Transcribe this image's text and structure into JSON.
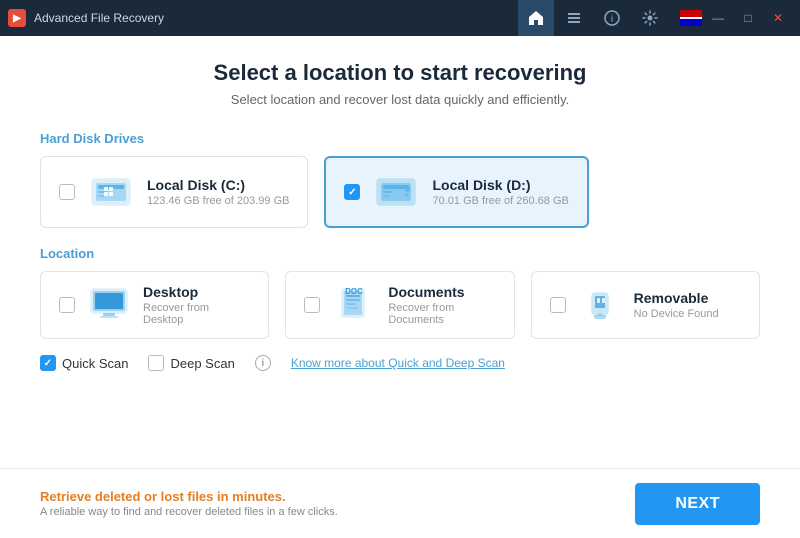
{
  "titlebar": {
    "app_name": "Advanced File Recovery",
    "tabs": [
      {
        "id": "home",
        "icon": "🏠",
        "active": true
      },
      {
        "id": "list",
        "icon": "☰",
        "active": false
      },
      {
        "id": "info",
        "icon": "ℹ",
        "active": false
      },
      {
        "id": "settings",
        "icon": "⚙",
        "active": false
      }
    ],
    "controls": {
      "minimize": "—",
      "maximize": "□",
      "close": "✕"
    }
  },
  "page": {
    "title": "Select a location to start recovering",
    "subtitle": "Select location and recover lost data quickly and efficiently."
  },
  "hard_disk_section": {
    "label": "Hard Disk Drives",
    "drives": [
      {
        "name": "Local Disk (C:)",
        "space": "123.46 GB free of 203.99 GB",
        "selected": false
      },
      {
        "name": "Local Disk (D:)",
        "space": "70.01 GB free of 260.68 GB",
        "selected": true
      }
    ]
  },
  "location_section": {
    "label": "Location",
    "locations": [
      {
        "name": "Desktop",
        "sub": "Recover from Desktop",
        "type": "desktop"
      },
      {
        "name": "Documents",
        "sub": "Recover from Documents",
        "type": "documents"
      },
      {
        "name": "Removable",
        "sub": "No Device Found",
        "type": "removable"
      }
    ]
  },
  "scan_options": {
    "quick_scan": {
      "label": "Quick Scan",
      "checked": true
    },
    "deep_scan": {
      "label": "Deep Scan",
      "checked": false
    },
    "learn_more_link": "Know more about Quick and Deep Scan"
  },
  "footer": {
    "promo": "Retrieve deleted or lost files in minutes.",
    "sub": "A reliable way to find and recover deleted files in a few clicks.",
    "next_button": "NEXT"
  }
}
